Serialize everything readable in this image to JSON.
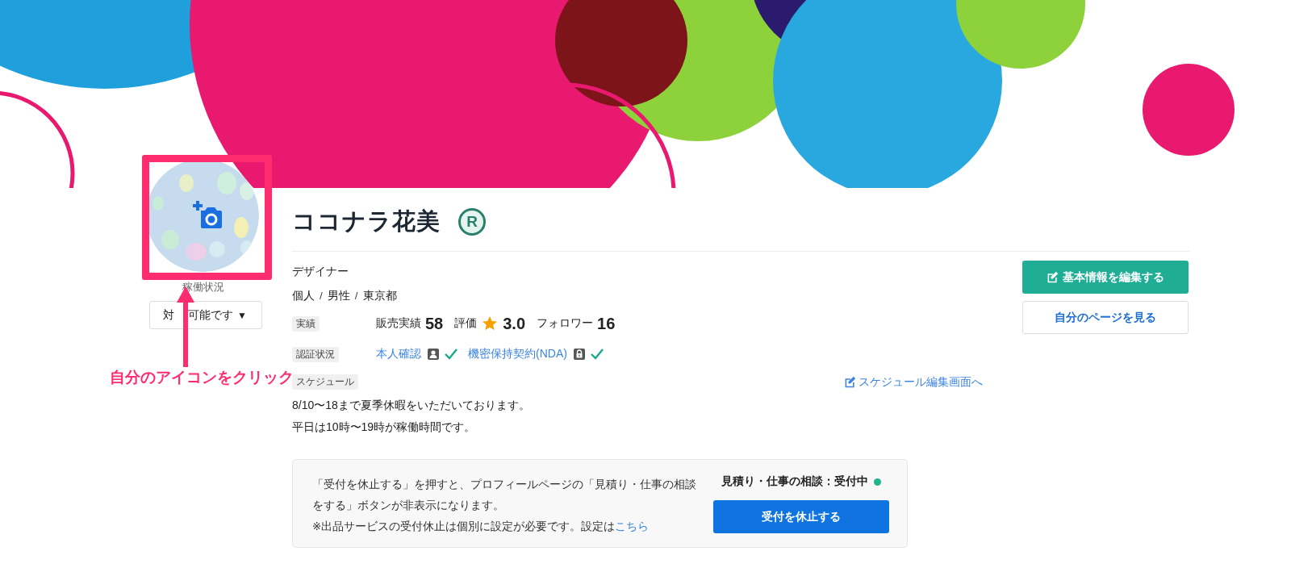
{
  "profile": {
    "name": "ココナラ花美",
    "badge": "R",
    "status_label": "稼働状況",
    "status_value_parts": [
      "対",
      "可能です"
    ],
    "status_caret": "▼",
    "occupation": "デザイナー",
    "attributes": [
      "個人",
      "男性",
      "東京都"
    ],
    "attribute_separator": "/"
  },
  "stats": {
    "tag": "実績",
    "items": [
      {
        "kind": "count",
        "label": "販売実績",
        "value": "58"
      },
      {
        "kind": "rating",
        "label": "評価",
        "value": "3.0"
      },
      {
        "kind": "count",
        "label": "フォロワー",
        "value": "16"
      }
    ]
  },
  "verification": {
    "tag": "認証状況",
    "items": [
      {
        "kind": "person",
        "label": "本人確認",
        "verified": true
      },
      {
        "kind": "lock",
        "label": "機密保持契約(NDA)",
        "verified": true
      }
    ]
  },
  "schedule": {
    "tag": "スケジュール",
    "edit_link": "スケジュール編集画面へ",
    "lines": [
      "8/10〜18まで夏季休暇をいただいております。",
      "平日は10時〜19時が稼働時間です。"
    ]
  },
  "actions": [
    {
      "kind": "primary",
      "label": "基本情報を編集する"
    },
    {
      "kind": "secondary",
      "label": "自分のページを見る"
    }
  ],
  "reception": {
    "notes": [
      "「受付を休止する」を押すと、プロフィールページの「見積り・仕事の相談をする」ボタンが非表示になります。",
      "※出品サービスの受付休止は個別に設定が必要です。設定は"
    ],
    "link": "こちら",
    "status": "見積り・仕事の相談：受付中",
    "open": true,
    "button": "受付を休止する"
  },
  "annotation": {
    "text": "自分のアイコンをクリック"
  }
}
